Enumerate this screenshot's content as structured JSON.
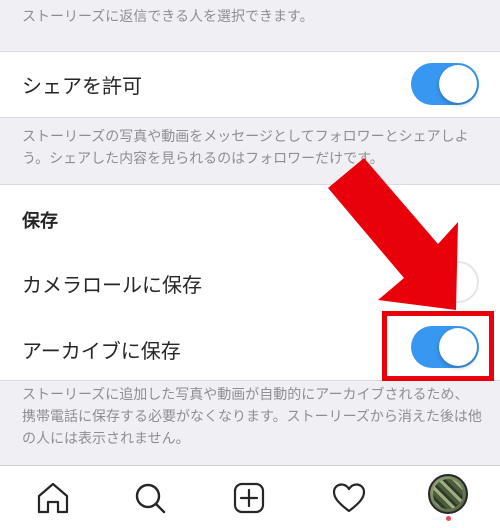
{
  "top_description": "ストーリーズに返信できる人を選択できます。",
  "share_row": {
    "label": "シェアを許可",
    "enabled": true
  },
  "share_description": "ストーリーズの写真や動画をメッセージとしてフォロワーとシェアしよう。シェアした内容を見られるのはフォロワーだけです。",
  "save_section": {
    "header": "保存",
    "camera_roll": {
      "label": "カメラロールに保存",
      "enabled": false
    },
    "archive": {
      "label": "アーカイブに保存",
      "enabled": true
    }
  },
  "archive_description": "ストーリーズに追加した写真や動画が自動的にアーカイブされるため、携帯電話に保存する必要がなくなります。ストーリーズから消えた後は他の人には表示されません。",
  "tabbar": {
    "items": [
      {
        "icon": "home-icon"
      },
      {
        "icon": "search-icon"
      },
      {
        "icon": "new-post-icon"
      },
      {
        "icon": "heart-icon"
      },
      {
        "icon": "profile-avatar"
      }
    ],
    "notification_dot_color": "#ed4956"
  },
  "colors": {
    "toggle_on": "#3897f0",
    "annotation": "#e8000b"
  }
}
